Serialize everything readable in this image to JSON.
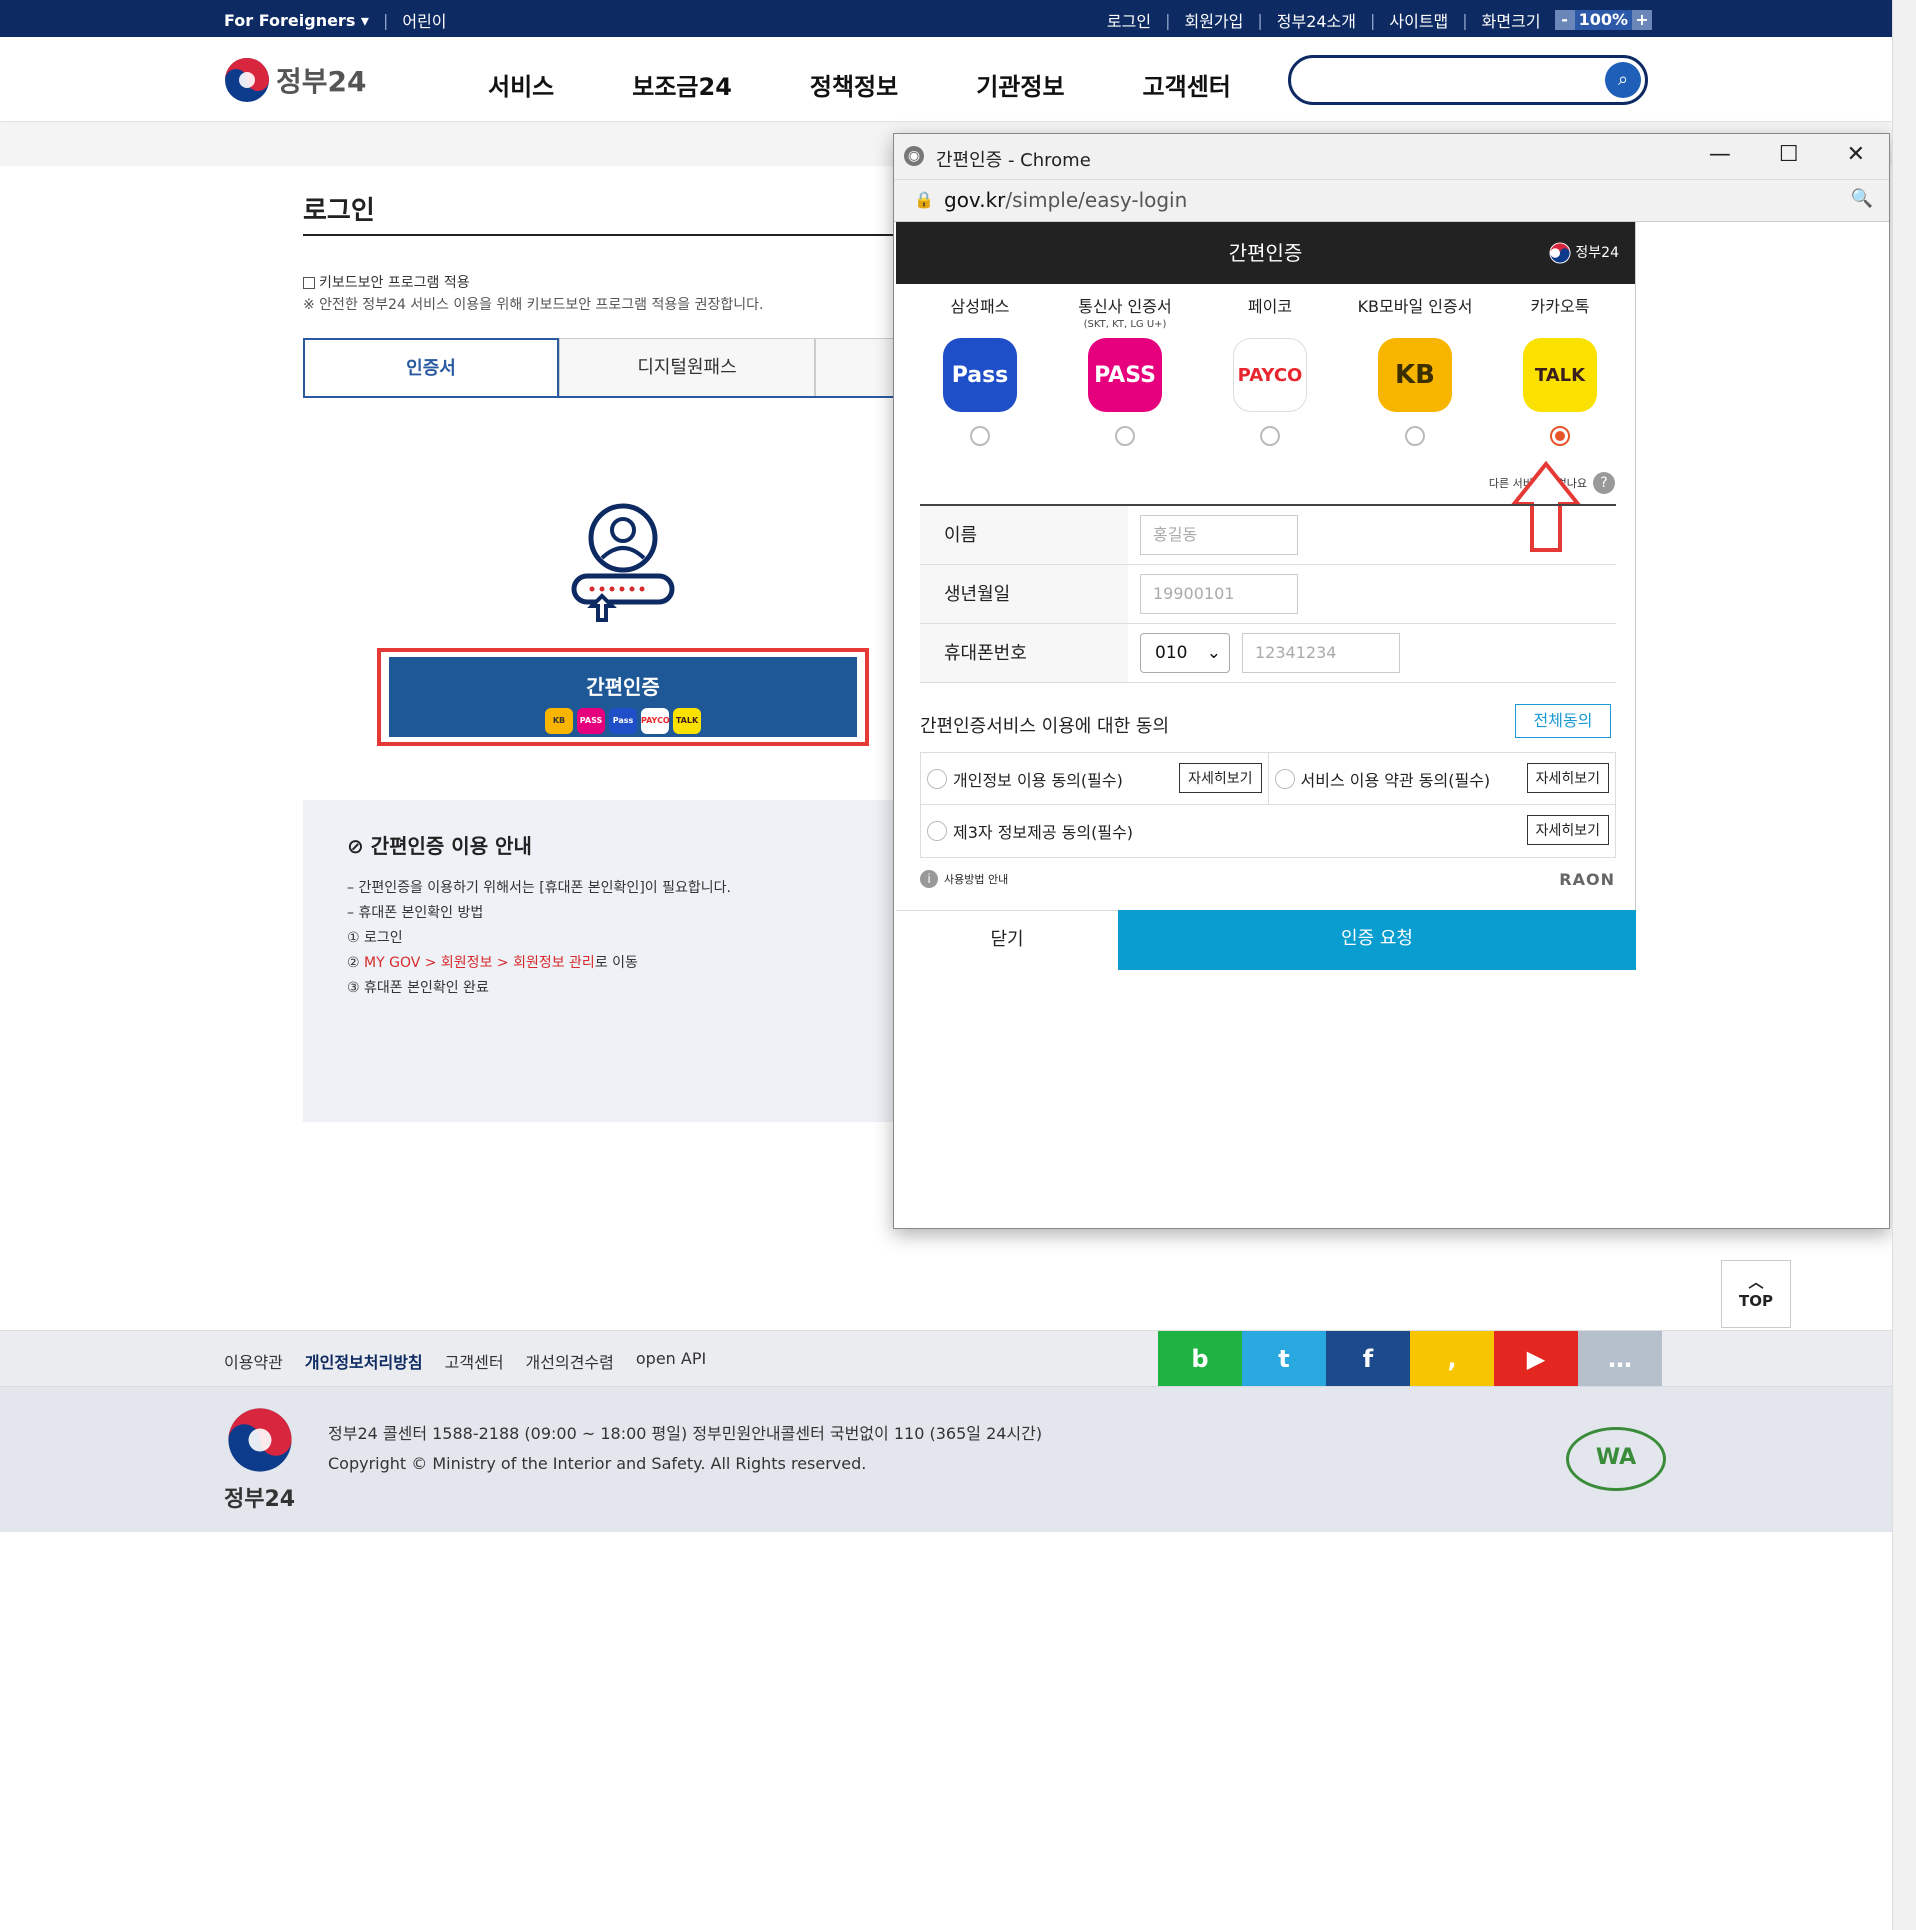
{
  "topbar": {
    "for_foreigners": "For Foreigners ▾",
    "children": "어린이",
    "login": "로그인",
    "signup": "회원가입",
    "about": "정부24소개",
    "sitemap": "사이트맵",
    "screen_size": "화면크기",
    "zoom_minus": "-",
    "zoom_value": "100%",
    "zoom_plus": "+"
  },
  "header": {
    "logo_text": "정부24",
    "nav": [
      "서비스",
      "보조금24",
      "정책정보",
      "기관정보",
      "고객센터"
    ],
    "search_placeholder": ""
  },
  "login": {
    "title": "로그인",
    "keyboard_security": "키보드보안 프로그램 적용",
    "keyboard_note": "※ 안전한 정부24 서비스 이용을 위해 키보드보안 프로그램 적용을 권장합니다.",
    "tabs": [
      "인증서",
      "디지털원패스",
      ""
    ],
    "easy_auth_button": "간편인증",
    "mini_icons": [
      "KB",
      "PASS",
      "Pass",
      "PAYCO",
      "TALK"
    ]
  },
  "guide": {
    "title": "간편인증 이용 안내",
    "line1": "간편인증을 이용하기 위해서는 [휴대폰 본인확인]이 필요합니다.",
    "line2": "휴대폰 본인확인 방법",
    "step1": "① 로그인",
    "step2_prefix": "② ",
    "step2_red": "MY GOV > 회원정보 > 회원정보 관리",
    "step2_suffix": "로 이동",
    "step3": "③ 휴대폰 본인확인 완료"
  },
  "popup": {
    "window_title": "간편인증 - Chrome",
    "minimize": "—",
    "maximize": "☐",
    "close": "✕",
    "url_domain": "gov.kr",
    "url_path": "/simple/easy-login",
    "header": "간편인증",
    "header_logo": "정부24",
    "providers": [
      {
        "name": "삼성패스",
        "sub": "",
        "icon": "Pass"
      },
      {
        "name": "통신사 인증서",
        "sub": "(SKT, KT, LG U+)",
        "icon": "PASS"
      },
      {
        "name": "페이코",
        "sub": "",
        "icon": "PAYCO"
      },
      {
        "name": "KB모바일 인증서",
        "sub": "",
        "icon": "KB"
      },
      {
        "name": "카카오톡",
        "sub": "",
        "icon": "TALK"
      }
    ],
    "other_services": "다른 서비스는 없나요",
    "form": {
      "name_label": "이름",
      "name_placeholder": "홍길동",
      "birth_label": "생년월일",
      "birth_placeholder": "19900101",
      "phone_label": "휴대폰번호",
      "phone_prefix": "010",
      "phone_placeholder": "12341234"
    },
    "agree_title": "간편인증서비스 이용에 대한 동의",
    "agree_all": "전체동의",
    "agree_items": [
      "개인정보 이용 동의(필수)",
      "서비스 이용 약관 동의(필수)",
      "제3자 정보제공 동의(필수)"
    ],
    "detail": "자세히보기",
    "howto": "사용방법 안내",
    "raon": "RAON",
    "cancel": "닫기",
    "request": "인증 요청"
  },
  "top_button": "TOP",
  "footer": {
    "links": [
      "이용약관",
      "개인정보처리방침",
      "고객센터",
      "개선의견수렴",
      "open API"
    ],
    "social": [
      "b",
      "t",
      "f",
      ",",
      "▶",
      "…"
    ],
    "logo_text": "정부24",
    "callcenter": "정부24 콜센터 1588-2188 (09:00 ~ 18:00 평일) 정부민원안내콜센터 국번없이 110 (365일 24시간)",
    "copyright": "Copyright © Ministry of the Interior and Safety. All Rights reserved.",
    "wa_mark": "WA"
  }
}
